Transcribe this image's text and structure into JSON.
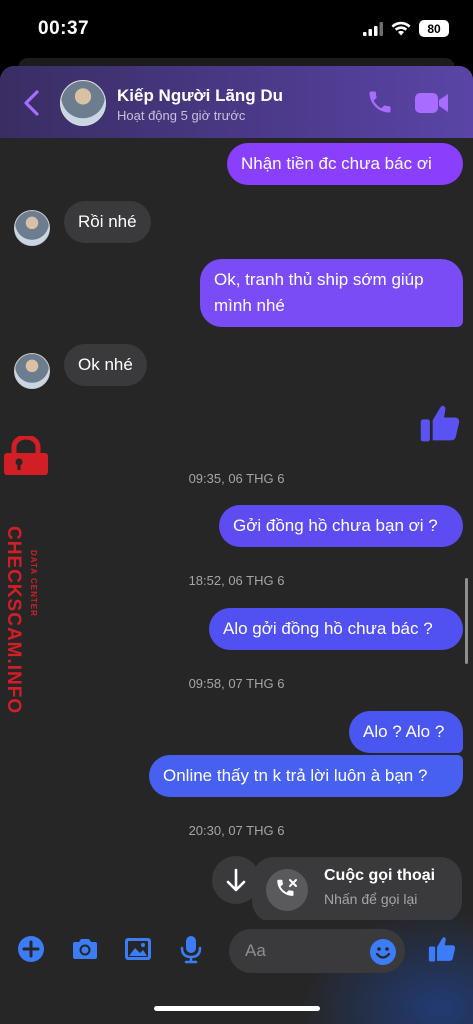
{
  "status_bar": {
    "time": "00:37",
    "battery": "80"
  },
  "header": {
    "contact_name": "Kiếp Người Lãng Du",
    "contact_status": "Hoạt động 5 giờ trước"
  },
  "messages": [
    {
      "text": "Nhận tiền đc chưa bác ơi"
    },
    {
      "text": "Rồi nhé"
    },
    {
      "line1": "Ok, tranh thủ ship sớm giúp",
      "line2": "mình nhé"
    },
    {
      "text": "Ok nhé"
    },
    {
      "text": "Gởi đồng hồ chưa bạn ơi ?"
    },
    {
      "text": "Alo gởi đồng hồ chưa bác ?"
    },
    {
      "text": "Alo ? Alo ?"
    },
    {
      "text": "Online thấy tn k trả lời luôn à bạn ?"
    }
  ],
  "timestamps": [
    "09:35, 06 THG 6",
    "18:52, 06 THG 6",
    "09:58, 07 THG 6",
    "20:30, 07 THG 6"
  ],
  "watermark": {
    "main": "CHECKSCAM.INFO",
    "sub": "DATA CENTER"
  },
  "call_card": {
    "title": "Cuộc gọi thoại",
    "subtitle": "Nhấn để gọi lại"
  },
  "composer": {
    "placeholder": "Aa"
  },
  "icons": [
    "back-icon",
    "phone-icon",
    "video-camera-icon",
    "thumbs-up-icon",
    "lock-icon",
    "arrow-down-icon",
    "missed-call-icon",
    "plus-icon",
    "camera-icon",
    "image-icon",
    "microphone-icon",
    "emoji-icon"
  ],
  "colors": {
    "accent": "#8a3ffc",
    "outgoing_blue": "#4a5af0",
    "incoming": "#3a3a3c",
    "watermark_red": "#d21f26"
  }
}
